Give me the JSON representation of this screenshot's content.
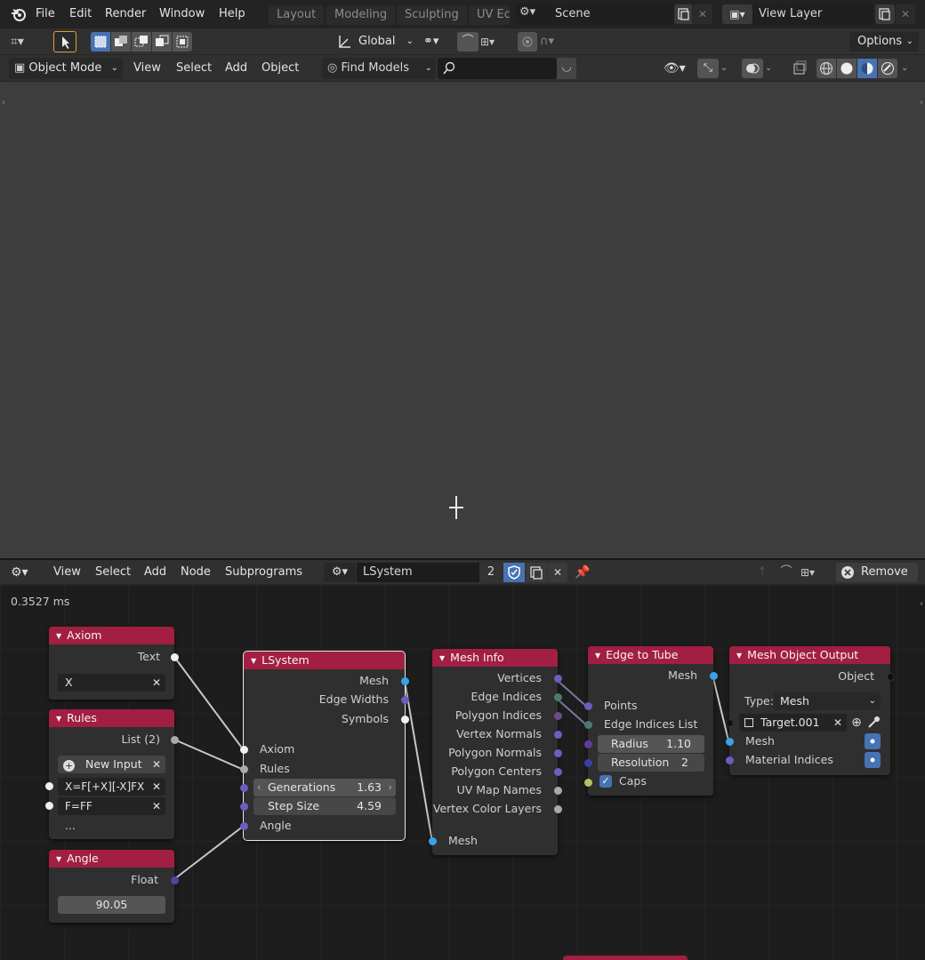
{
  "topbar": {
    "menus": [
      "File",
      "Edit",
      "Render",
      "Window",
      "Help"
    ],
    "workspaces": [
      "Layout",
      "Modeling",
      "Sculpting",
      "UV Ec"
    ],
    "scene": "Scene",
    "view_layer": "View Layer"
  },
  "tool_header": {
    "orientation": "Global",
    "options_label": "Options"
  },
  "viewport_header": {
    "mode": "Object Mode",
    "menus": [
      "View",
      "Select",
      "Add",
      "Object"
    ],
    "find_models": "Find Models"
  },
  "node_header": {
    "menus": [
      "View",
      "Select",
      "Add",
      "Node",
      "Subprograms"
    ],
    "tree_name": "LSystem",
    "users": "2",
    "remove_label": "Remove"
  },
  "node_editor": {
    "timing": "0.3527 ms"
  },
  "nodes": {
    "axiom": {
      "title": "Axiom",
      "output": "Text",
      "value": "X"
    },
    "rules": {
      "title": "Rules",
      "output": "List (2)",
      "new_input": "New Input",
      "items": [
        "X=F[+X][-X]FX",
        "F=FF"
      ],
      "more": "..."
    },
    "angle": {
      "title": "Angle",
      "output": "Float",
      "value": "90.05"
    },
    "lsystem": {
      "title": "LSystem",
      "outputs": [
        "Mesh",
        "Edge Widths",
        "Symbols"
      ],
      "inputs": [
        "Axiom",
        "Rules",
        "Angle"
      ],
      "generations_label": "Generations",
      "generations_value": "1.63",
      "step_label": "Step Size",
      "step_value": "4.59"
    },
    "mesh_info": {
      "title": "Mesh Info",
      "outputs": [
        "Vertices",
        "Edge Indices",
        "Polygon Indices",
        "Vertex Normals",
        "Polygon Normals",
        "Polygon Centers",
        "UV Map Names",
        "Vertex Color Layers"
      ],
      "input": "Mesh"
    },
    "edge_to_tube": {
      "title": "Edge to Tube",
      "output": "Mesh",
      "inputs": [
        "Points",
        "Edge Indices List"
      ],
      "radius_label": "Radius",
      "radius_value": "1.10",
      "resolution_label": "Resolution",
      "resolution_value": "2",
      "caps_label": "Caps"
    },
    "mesh_output": {
      "title": "Mesh Object Output",
      "output": "Object",
      "type_label": "Type:",
      "type_value": "Mesh",
      "target": "Target.001",
      "inputs": [
        "Mesh",
        "Material Indices"
      ]
    }
  },
  "colors": {
    "node_header": "#a21e42",
    "accent_blue": "#4772b3"
  }
}
